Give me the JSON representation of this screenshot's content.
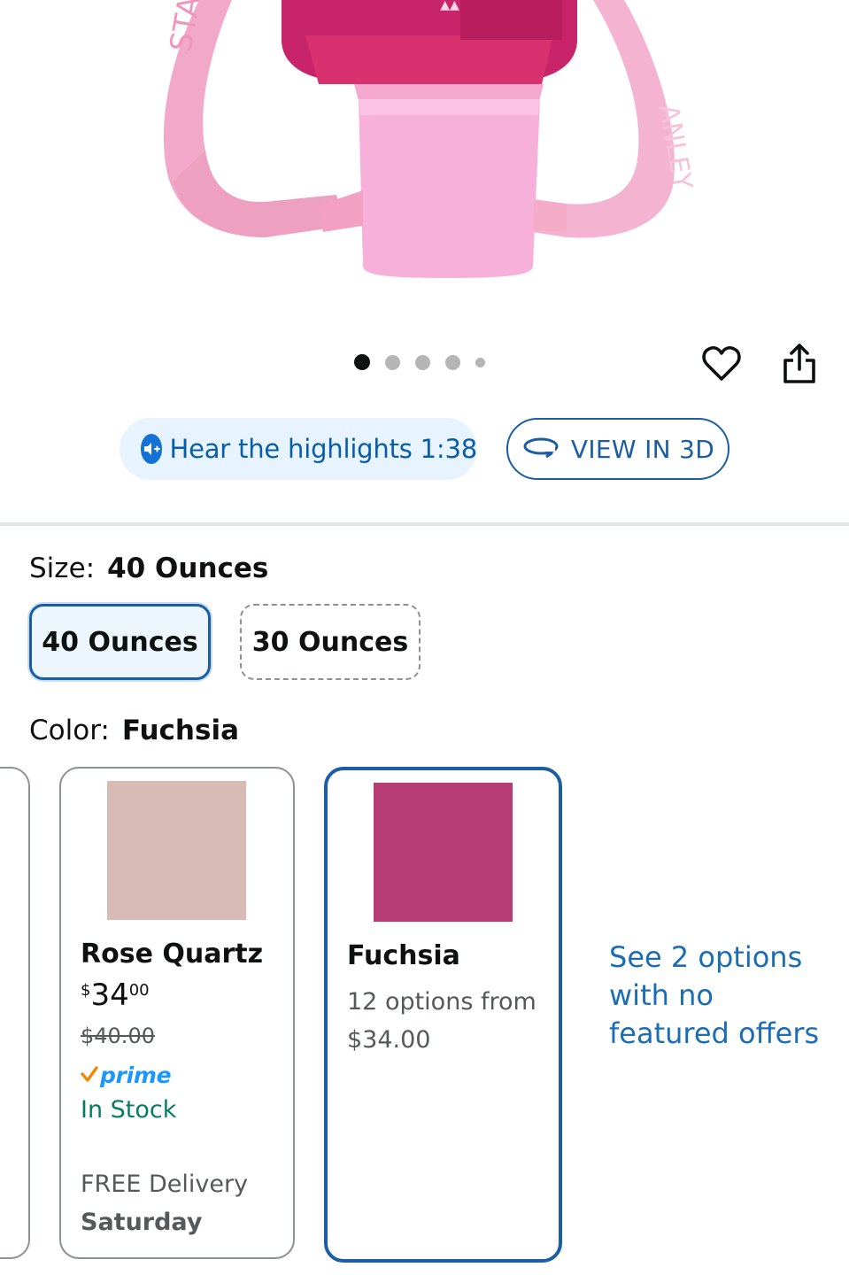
{
  "gallery": {
    "dot_count": 5,
    "active_index": 0
  },
  "actions": {
    "favorite_icon": "heart-icon",
    "share_icon": "share-icon"
  },
  "audio": {
    "label": "Hear the highlights 1:38"
  },
  "view3d": {
    "label": "VIEW IN 3D"
  },
  "size": {
    "key": "Size:",
    "selected": "40 Ounces",
    "options": [
      "40 Ounces",
      "30 Ounces"
    ]
  },
  "color": {
    "key": "Color:",
    "selected": "Fuchsia",
    "cards": [
      {
        "name": "Rose Quartz",
        "swatch": "#d8bbb5",
        "price_symbol": "$",
        "price_whole": "34",
        "price_fraction": "00",
        "list_price": "$40.00",
        "prime": "prime",
        "stock": "In Stock",
        "delivery": "FREE Delivery",
        "delivery_day": "Saturday"
      },
      {
        "name": "Fuchsia",
        "swatch": "#b83c74",
        "options_line1": "12 options from",
        "options_line2": "$34.00"
      }
    ],
    "see_more": "See 2 options with no featured offers"
  },
  "colors": {
    "accent": "#1b5ea4",
    "link": "#1b6db4",
    "in_stock": "#067d62",
    "prime": "#1a98ff"
  }
}
